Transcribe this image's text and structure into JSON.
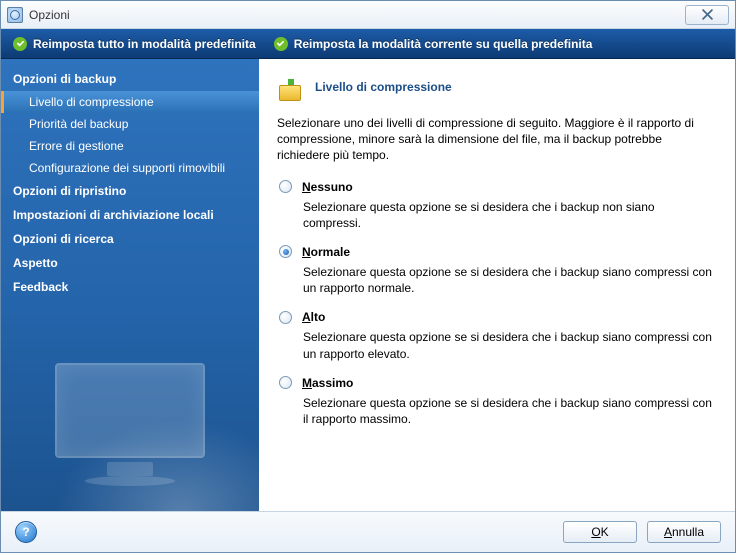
{
  "window": {
    "title": "Opzioni"
  },
  "toolbar": {
    "reset_all": "Reimposta tutto in modalità predefinita",
    "reset_current": "Reimposta la modalità corrente su quella predefinita"
  },
  "sidebar": {
    "categories": [
      {
        "label": "Opzioni di backup",
        "expanded": true,
        "items": [
          {
            "label": "Livello di compressione",
            "selected": true
          },
          {
            "label": "Priorità del backup",
            "selected": false
          },
          {
            "label": "Errore di gestione",
            "selected": false
          },
          {
            "label": "Configurazione dei supporti rimovibili",
            "selected": false
          }
        ]
      },
      {
        "label": "Opzioni di ripristino",
        "items": []
      },
      {
        "label": "Impostazioni di archiviazione locali",
        "items": []
      },
      {
        "label": "Opzioni di ricerca",
        "items": []
      },
      {
        "label": "Aspetto",
        "items": []
      },
      {
        "label": "Feedback",
        "items": []
      }
    ]
  },
  "content": {
    "heading": "Livello di compressione",
    "intro": "Selezionare uno dei livelli di compressione di seguito. Maggiore è il rapporto di compressione, minore sarà la dimensione del file, ma il backup potrebbe richiedere più tempo.",
    "options": [
      {
        "accel": "N",
        "rest": "essuno",
        "selected": false,
        "desc": "Selezionare questa opzione se si desidera che i backup non siano compressi."
      },
      {
        "accel": "N",
        "rest": "ormale",
        "selected": true,
        "desc": "Selezionare questa opzione se si desidera che i backup siano compressi con un rapporto normale."
      },
      {
        "accel": "A",
        "rest": "lto",
        "selected": false,
        "desc": "Selezionare questa opzione se si desidera che i backup siano compressi con un rapporto elevato."
      },
      {
        "accel": "M",
        "rest": "assimo",
        "selected": false,
        "desc": "Selezionare questa opzione se si desidera che i backup siano compressi con il rapporto massimo."
      }
    ]
  },
  "buttons": {
    "help": "?",
    "ok_accel": "O",
    "ok_rest": "K",
    "cancel_accel": "A",
    "cancel_rest": "nnulla"
  }
}
